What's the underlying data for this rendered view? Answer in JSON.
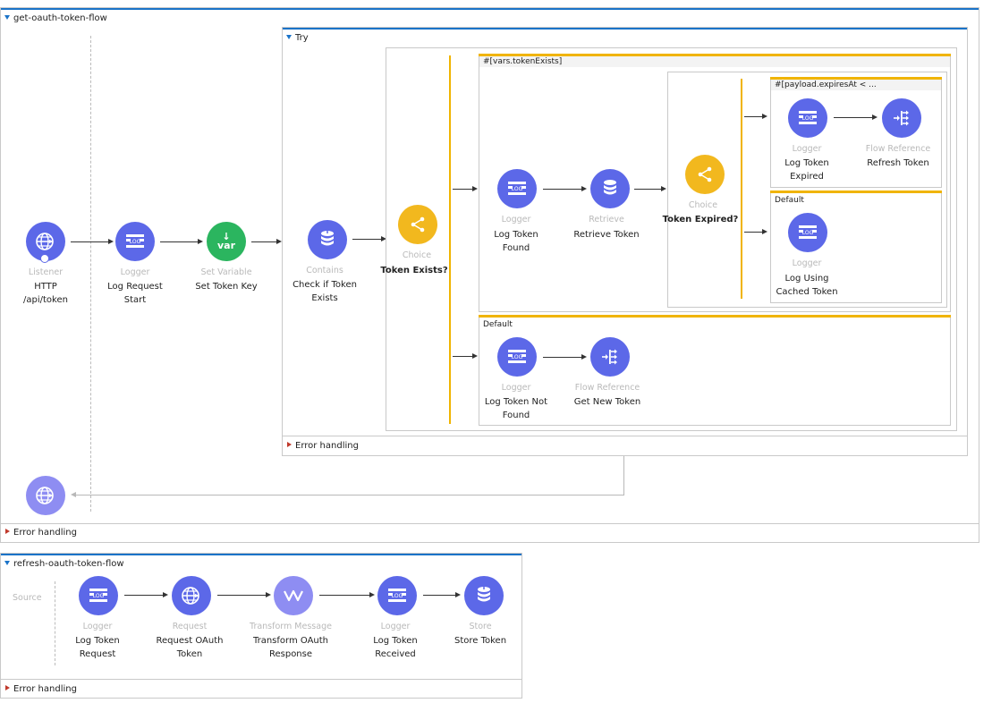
{
  "flow1": {
    "title": "get-oauth-token-flow",
    "error_handling": "Error handling",
    "source": {
      "type": "Listener",
      "label": "HTTP\n/api/token",
      "icon": "globe-icon"
    },
    "logger_start": {
      "type": "Logger",
      "label": "Log Request\nStart",
      "icon": "logger-icon"
    },
    "set_variable": {
      "type": "Set Variable",
      "label": "Set Token Key",
      "icon": "var-icon",
      "icon_text": "var"
    },
    "try": {
      "title": "Try",
      "error_handling": "Error handling",
      "contains": {
        "type": "Contains",
        "label": "Check if Token\nExists",
        "icon": "database-icon"
      },
      "choice1": {
        "type": "Choice",
        "label": "Token Exists?",
        "icon": "choice-icon",
        "route_when": {
          "expr": "#[vars.tokenExists]",
          "logger_found": {
            "type": "Logger",
            "label": "Log Token\nFound"
          },
          "retrieve": {
            "type": "Retrieve",
            "label": "Retrieve Token"
          },
          "choice2": {
            "type": "Choice",
            "label": "Token Expired?",
            "route_when": {
              "expr": "#[payload.expiresAt < ...",
              "logger_expired": {
                "type": "Logger",
                "label": "Log Token\nExpired"
              },
              "flow_ref_refresh": {
                "type": "Flow Reference",
                "label": "Refresh Token"
              }
            },
            "route_default": {
              "title": "Default",
              "logger_cached": {
                "type": "Logger",
                "label": "Log Using\nCached Token"
              }
            }
          }
        },
        "route_default": {
          "title": "Default",
          "logger_not_found": {
            "type": "Logger",
            "label": "Log Token Not\nFound"
          },
          "flow_ref_new": {
            "type": "Flow Reference",
            "label": "Get New Token"
          }
        }
      }
    }
  },
  "flow2": {
    "title": "refresh-oauth-token-flow",
    "source_label": "Source",
    "error_handling": "Error handling",
    "steps": [
      {
        "type": "Logger",
        "label": "Log Token\nRequest",
        "icon": "logger-icon"
      },
      {
        "type": "Request",
        "label": "Request OAuth\nToken",
        "icon": "globe-icon"
      },
      {
        "type": "Transform Message",
        "label": "Transform OAuth\nResponse",
        "icon": "transform-icon"
      },
      {
        "type": "Logger",
        "label": "Log Token\nReceived",
        "icon": "logger-icon"
      },
      {
        "type": "Store",
        "label": "Store Token",
        "icon": "database-icon"
      }
    ]
  },
  "colors": {
    "accent": "#1a73c8",
    "processor_blue": "#5c68e8",
    "set_variable_green": "#2bb55f",
    "choice_yellow": "#f2b81e",
    "error_red": "#c0392b"
  }
}
